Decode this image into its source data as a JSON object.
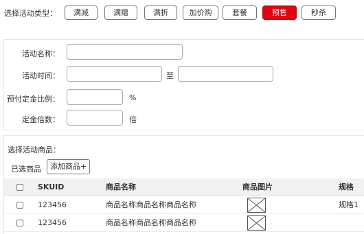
{
  "activity_type": {
    "label": "选择活动类型：",
    "options": [
      "满减",
      "满赠",
      "满折",
      "加价购",
      "套餐",
      "预售",
      "秒杀"
    ],
    "selected": "预售"
  },
  "form": {
    "name_label": "活动名称：",
    "time_label": "活动时间：",
    "time_separator": "至",
    "deposit_ratio_label": "预付定金比例：",
    "deposit_ratio_unit": "%",
    "deposit_multiple_label": "定金倍数：",
    "deposit_multiple_unit": "倍"
  },
  "goods": {
    "title": "选择活动商品：",
    "selected_label": "已选商品",
    "add_button": "添加商品+",
    "columns": [
      "SKUID",
      "商品名称",
      "商品图片",
      "规格"
    ],
    "rows": [
      {
        "skuid": "123456",
        "name": "商品名称商品名称商品名称",
        "spec": "规格1"
      },
      {
        "skuid": "123456",
        "name": "商品名称商品名称商品名称",
        "spec": ""
      }
    ]
  },
  "colors": {
    "active_button": "#e60012"
  }
}
